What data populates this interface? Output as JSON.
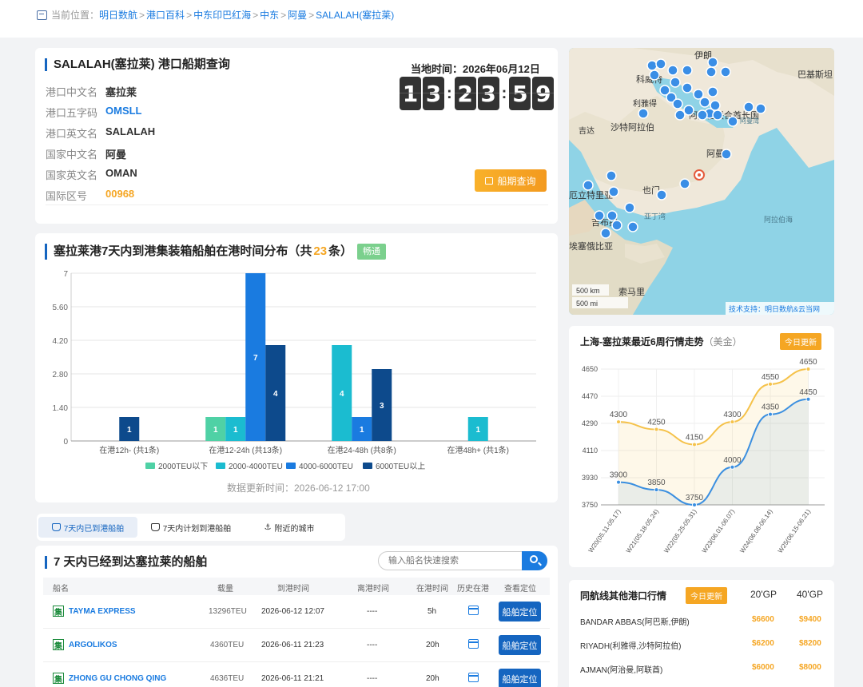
{
  "breadcrumb": {
    "prefix": "当前位置：",
    "items": [
      "明日数航",
      "港口百科",
      "中东印巴红海",
      "中东",
      "阿曼",
      "SALALAH(塞拉莱)"
    ],
    "separator": ">"
  },
  "port": {
    "title": "SALALAH(塞拉莱) 港口船期查询",
    "fields": [
      {
        "label": "港口中文名",
        "value": "塞拉莱"
      },
      {
        "label": "港口五字码",
        "value": "OMSLL"
      },
      {
        "label": "港口英文名",
        "value": "SALALAH"
      },
      {
        "label": "国家中文名",
        "value": "阿曼"
      },
      {
        "label": "国家英文名",
        "value": "OMAN"
      },
      {
        "label": "国际区号",
        "value": "00968"
      }
    ],
    "local_time_label": "当地时间：2026年06月12日",
    "clock_digits": [
      "1",
      "3",
      "2",
      "3",
      "5",
      "9"
    ],
    "schedule_button": "船期查询"
  },
  "map": {
    "labels": {
      "iran": "伊朗",
      "pakistan": "巴基斯坦",
      "kuwait": "科威特",
      "riyadh": "利雅得",
      "saudi": "沙特阿拉伯",
      "uae": "阿拉伯联合酋长国",
      "jeddah": "吉达",
      "oman": "阿曼",
      "eritrea": "厄立特里亚",
      "yemen": "也门",
      "aden_gulf": "亚丁湾",
      "arabian_sea": "阿拉伯海",
      "djibouti": "吉布提",
      "ethiopia": "埃塞俄比亚",
      "somalia": "索马里",
      "gulf_oman": "阿曼湾"
    },
    "scale_km": "500 km",
    "scale_mi": "500 mi",
    "credit": "技术支持：明日数航&云当网"
  },
  "distribution": {
    "title_prefix": "塞拉莱港7天内到港集装箱船舶在港时间分布（共",
    "total": "23",
    "title_suffix": "条）",
    "status": "畅通",
    "update_note": "数据更新时间：2026-06-12 17:00"
  },
  "chart_data": {
    "type": "bar",
    "categories": [
      "在港12h- (共1条)",
      "在港12-24h (共13条)",
      "在港24-48h (共8条)",
      "在港48h+ (共1条)"
    ],
    "series": [
      {
        "name": "2000TEU以下",
        "color": "#4fd1a5",
        "values": [
          0,
          1,
          0,
          0
        ]
      },
      {
        "name": "2000-4000TEU",
        "color": "#1bbcd0",
        "values": [
          0,
          1,
          4,
          1
        ]
      },
      {
        "name": "4000-6000TEU",
        "color": "#1a7be0",
        "values": [
          0,
          7,
          1,
          0
        ]
      },
      {
        "name": "6000TEU以上",
        "color": "#0d4a8c",
        "values": [
          1,
          4,
          3,
          0
        ]
      }
    ],
    "yticks": [
      "0",
      "1.40",
      "2.80",
      "4.20",
      "5.60",
      "7"
    ],
    "ylim": [
      0,
      7
    ]
  },
  "tabs": [
    {
      "label": "7天内已到港船舶"
    },
    {
      "label": "7天内计划到港船舶"
    },
    {
      "label": "附近的城市"
    }
  ],
  "ships": {
    "title": "7 天内已经到达塞拉莱的船舶",
    "search_placeholder": "输入船名快速搜索",
    "headers": [
      "船名",
      "载量",
      "到港时间",
      "离港时间",
      "在港时间",
      "历史在港",
      "查看定位"
    ],
    "tag": "集",
    "locate_label": "船舶定位",
    "rows": [
      {
        "name": "TAYMA EXPRESS",
        "capacity": "13296TEU",
        "arrival": "2026-06-12 12:07",
        "departure": "----",
        "duration": "5h"
      },
      {
        "name": "ARGOLIKOS",
        "capacity": "4360TEU",
        "arrival": "2026-06-11 21:23",
        "departure": "----",
        "duration": "20h"
      },
      {
        "name": "ZHONG GU CHONG QING",
        "capacity": "4636TEU",
        "arrival": "2026-06-11 21:21",
        "departure": "----",
        "duration": "20h"
      }
    ]
  },
  "trend": {
    "title": "上海-塞拉莱最近6周行情走势",
    "unit": "（美金）",
    "badge": "今日更新"
  },
  "trend_chart": {
    "type": "line",
    "x": [
      "W20(05.11-05.17)",
      "W21(05.18-05.24)",
      "W22(05.25-05.31)",
      "W23(06.01-06.07)",
      "W24(06.08-06.14)",
      "W25(06.15-06.21)"
    ],
    "series": [
      {
        "name": "40'GP",
        "color": "#f5c24a",
        "values": [
          4300,
          4250,
          4150,
          4300,
          4550,
          4650
        ]
      },
      {
        "name": "20'GP",
        "color": "#3b8fe0",
        "values": [
          3900,
          3850,
          3750,
          4000,
          4350,
          4450
        ]
      }
    ],
    "yticks": [
      "3750",
      "3930",
      "4110",
      "4290",
      "4470",
      "4650"
    ],
    "ylim": [
      3750,
      4650
    ]
  },
  "other_ports": {
    "title": "同航线其他港口行情",
    "badge": "今日更新",
    "col1": "20'GP",
    "col2": "40'GP",
    "rows": [
      {
        "port": "BANDAR ABBAS(阿巴斯,伊朗)",
        "p20": "$6600",
        "p40": "$9400"
      },
      {
        "port": "RIYADH(利雅得,沙特阿拉伯)",
        "p20": "$6200",
        "p40": "$8200"
      },
      {
        "port": "AJMAN(阿治曼,阿联酋)",
        "p20": "$6000",
        "p40": "$8000"
      }
    ]
  },
  "colors": {
    "primary": "#1a7be0",
    "dark_blue": "#1565c0",
    "orange": "#f5a623",
    "green": "#7bd08d"
  }
}
